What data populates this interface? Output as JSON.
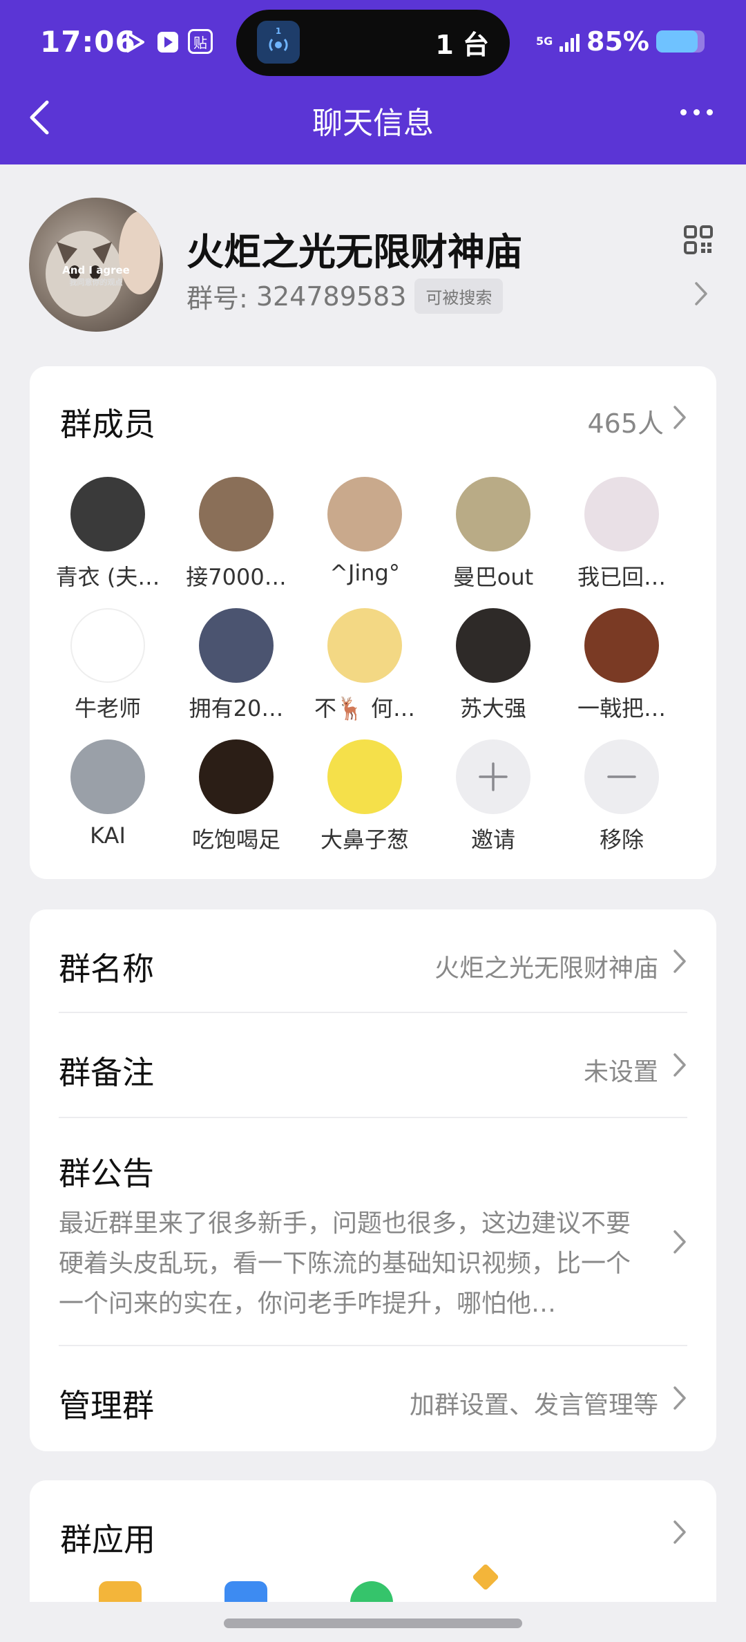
{
  "status_bar": {
    "time": "17:06",
    "island_app_badge": "1",
    "island_text": "1 台",
    "network": "5G",
    "battery_pct": "85%",
    "battery_level": 0.85
  },
  "nav": {
    "title": "聊天信息"
  },
  "group": {
    "name": "火炬之光无限财神庙",
    "id_label": "群号:",
    "id": "324789583",
    "searchable_badge": "可被搜索",
    "avatar_caption_1": "And I agree",
    "avatar_caption_2": "我同意你的观点"
  },
  "members": {
    "title": "群成员",
    "count": "465人",
    "list": [
      {
        "name": "青衣 (夫…",
        "color": "#3a3a3a"
      },
      {
        "name": "接7000…",
        "color": "#8a6f58"
      },
      {
        "name": "^Jing°",
        "color": "#c9a98c"
      },
      {
        "name": "曼巴out",
        "color": "#b9ab86"
      },
      {
        "name": "我已回…",
        "color": "#e9e0e6"
      },
      {
        "name": "牛老师",
        "color": "#ffffff"
      },
      {
        "name": "拥有20…",
        "color": "#4b5470"
      },
      {
        "name": "不🦌 何…",
        "color": "#f3d884"
      },
      {
        "name": "苏大强",
        "color": "#2e2a28"
      },
      {
        "name": "一戟把…",
        "color": "#7a3a24"
      },
      {
        "name": "KAI",
        "color": "#9aa0a8"
      },
      {
        "name": "吃饱喝足",
        "color": "#2b1e16"
      },
      {
        "name": "大鼻子葱",
        "color": "#f5e04a"
      }
    ],
    "invite_label": "邀请",
    "remove_label": "移除"
  },
  "settings": {
    "name_label": "群名称",
    "name_value": "火炬之光无限财神庙",
    "remark_label": "群备注",
    "remark_value": "未设置",
    "notice_label": "群公告",
    "notice_text": "最近群里来了很多新手，问题也很多，这边建议不要硬着头皮乱玩，看一下陈流的基础知识视频，比一个一个问来的实在，你问老手咋提升，哪怕他…",
    "manage_label": "管理群",
    "manage_value": "加群设置、发言管理等"
  },
  "apps": {
    "title": "群应用",
    "icons": [
      {
        "name": "folder-icon",
        "color": "#f3b53a"
      },
      {
        "name": "album-icon",
        "color": "#3d8bf2"
      },
      {
        "name": "star-app-icon",
        "color": "#35c46b"
      },
      {
        "name": "sparkle-icon",
        "color": "#f3b53a"
      }
    ]
  },
  "colors": {
    "accent": "#5b35d5",
    "background": "#efeff2"
  }
}
